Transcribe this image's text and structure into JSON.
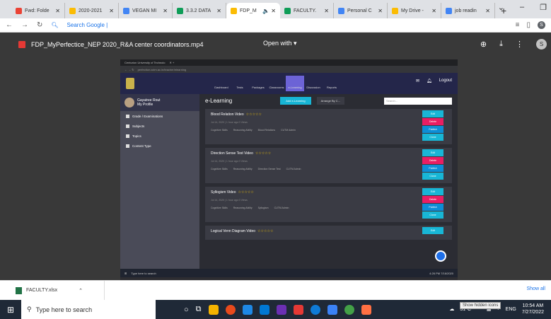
{
  "browser": {
    "tabs": [
      {
        "label": "Fwd: Folde",
        "color": "#ea4335"
      },
      {
        "label": "2020-2021",
        "color": "#fbbc04"
      },
      {
        "label": "VEGAN MI",
        "color": "#4285f4"
      },
      {
        "label": "3.3.2 DATA",
        "color": "#0f9d58"
      },
      {
        "label": "FDP_M",
        "color": "#fbbc04"
      },
      {
        "label": "FACULTY.",
        "color": "#0f9d58"
      },
      {
        "label": "Personal C",
        "color": "#4285f4"
      },
      {
        "label": "My Drive -",
        "color": "#fbbc04"
      },
      {
        "label": "job readin",
        "color": "#4285f4"
      }
    ],
    "new_tab": "+",
    "address_text": "Search Google |",
    "profile_initial": "S"
  },
  "viewer": {
    "file_name": "FDP_MyPerfectice_NEP 2020_R&A center coordinators.mp4",
    "open_with": "Open with ▾",
    "profile_initial": "S"
  },
  "video": {
    "tab_title": "Centurion University of Technolo",
    "url": "perfectice.cutm.ac.in/teacher/elearning",
    "nav": [
      "Dashboard",
      "Tests",
      "Packages",
      "Classrooms",
      "e-Learning",
      "Discussion",
      "Reports"
    ],
    "logout": "Logout",
    "user_name": "Gayatree Rout",
    "my_profile": "My Profile",
    "sidebar_items": [
      "Grade / Examinations",
      "Subjects",
      "Topics",
      "Content Type"
    ],
    "page_title": "e-Learning",
    "add_button": "Add e-Learning",
    "arrange": "Arrange By C...",
    "search_placeholder": "Search...",
    "cards": [
      {
        "title": "Blood Relation Video",
        "date": "Jul 14, 2020 | 1 hour ago",
        "views": "0 Views",
        "tags": [
          "Cognitive Skills",
          "Reasoning Ability",
          "Blood Relations",
          "CUTM Admin"
        ]
      },
      {
        "title": "Direction Sense Test Video",
        "date": "Jul 14, 2020 | 1 hour ago",
        "views": "0 Views",
        "tags": [
          "Cognitive Skills",
          "Reasoning Ability",
          "Direction Sense Test",
          "CUTM Admin"
        ]
      },
      {
        "title": "Syllogism Video",
        "date": "Jul 14, 2020 | 1 hour ago",
        "views": "0 Views",
        "tags": [
          "Cognitive Skills",
          "Reasoning Ability",
          "Syllogism",
          "CUTM Admin"
        ]
      },
      {
        "title": "Logical Venn Diagram Video",
        "date": "",
        "views": "",
        "tags": []
      }
    ],
    "card_buttons": [
      "Edit",
      "Delete",
      "Publish",
      "Clone"
    ],
    "stars": "☆☆☆☆☆",
    "taskbar_search": "Type here to search",
    "time": "4:26 PM",
    "date": "7/16/2020"
  },
  "downloads": {
    "file": "FACULTY.xlsx",
    "show_all": "Show all"
  },
  "taskbar": {
    "search_placeholder": "Type here to search",
    "weather": "31°C",
    "tooltip": "Show hidden icons",
    "lang": "ENG",
    "time": "10:54 AM",
    "date": "7/27/2022"
  }
}
